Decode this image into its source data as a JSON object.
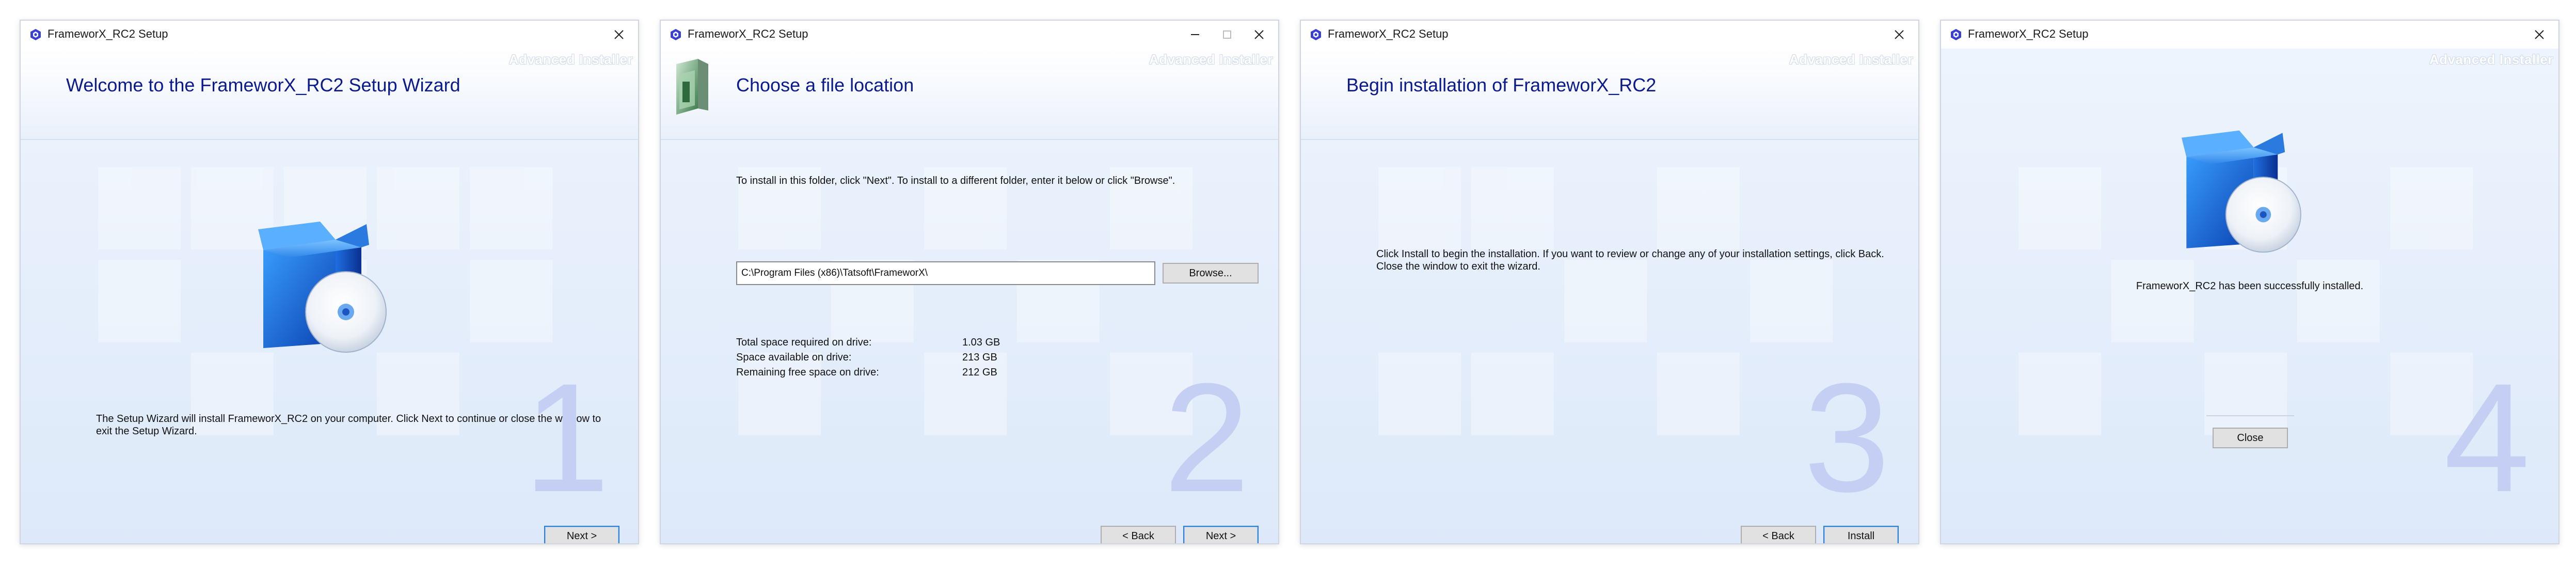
{
  "brand": "Advanced Installer",
  "windows": [
    {
      "title": "FrameworX_RC2 Setup",
      "heading": "Welcome to the FrameworX_RC2 Setup Wizard",
      "body_text": "The Setup Wizard will install FrameworX_RC2 on your computer. Click Next to continue or close the window to exit the Setup Wizard.",
      "step": "1",
      "next_label": "Next >"
    },
    {
      "title": "FrameworX_RC2 Setup",
      "heading": "Choose a file location",
      "instruction": "To install in this folder, click \"Next\". To install to a different folder, enter it below or click \"Browse\".",
      "path_value": "C:\\Program Files (x86)\\Tatsoft\\FrameworX\\",
      "browse_label": "Browse...",
      "space": [
        {
          "label": "Total space required on drive:",
          "value": "1.03 GB"
        },
        {
          "label": "Space available on drive:",
          "value": "213 GB"
        },
        {
          "label": "Remaining free space on drive:",
          "value": "212 GB"
        }
      ],
      "step": "2",
      "back_label": "< Back",
      "next_label": "Next >"
    },
    {
      "title": "FrameworX_RC2 Setup",
      "heading": "Begin installation of FrameworX_RC2",
      "body_text": "Click Install to begin the installation.  If you want to review or change any of your installation settings, click Back.  Close the window to exit the wizard.",
      "step": "3",
      "back_label": "< Back",
      "install_label": "Install"
    },
    {
      "title": "FrameworX_RC2 Setup",
      "success_text": "FrameworX_RC2 has been successfully installed.",
      "step": "4",
      "close_label": "Close"
    }
  ],
  "colors": {
    "heading": "#0b1a8c",
    "step_number": "#c4cff3",
    "primary_border": "#2f7fd6"
  }
}
